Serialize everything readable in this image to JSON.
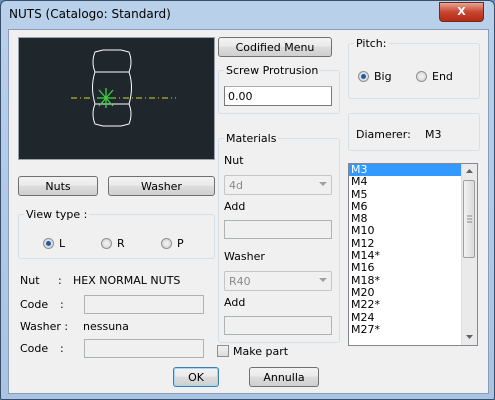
{
  "window": {
    "title": "NUTS (Catalogo: Standard)",
    "close_glyph": "X"
  },
  "buttons": {
    "codified_menu": "Codified Menu",
    "nuts": "Nuts",
    "washer": "Washer",
    "ok": "OK",
    "cancel": "Annulla"
  },
  "screw_protrusion": {
    "label": "Screw Protrusion",
    "value": "0.00"
  },
  "view_type": {
    "label": "View type  :",
    "options": [
      "L",
      "R",
      "P"
    ],
    "selected": "L"
  },
  "info": {
    "nut_label": "Nut",
    "nut_sep": ":",
    "nut_value": "HEX NORMAL NUTS",
    "code_label": "Code",
    "code_sep": ":",
    "washer_label": "Washer :",
    "washer_value": "nessuna",
    "code2_label": "Code",
    "code2_sep": ":"
  },
  "materials": {
    "label": "Materials",
    "nut_label": "Nut",
    "nut_value": "4d",
    "add1_label": "Add",
    "washer_label": "Washer",
    "washer_value": "R40",
    "add2_label": "Add"
  },
  "make_part": {
    "label": "Make part",
    "checked": false
  },
  "pitch": {
    "label": "Pitch:",
    "options": [
      "Big",
      "End"
    ],
    "selected": "Big"
  },
  "diameter": {
    "label": "Diamerer:",
    "value": "M3"
  },
  "sizes": {
    "items": [
      "M3",
      "M4",
      "M5",
      "M6",
      "M8",
      "M10",
      "M12",
      "M14*",
      "M16",
      "M18*",
      "M20",
      "M22*",
      "M24",
      "M27*"
    ],
    "selected": "M3"
  },
  "colors": {
    "preview_bg": "#1f262c",
    "crosshair": "#3fd03f",
    "centerline": "#d6d62a",
    "selection": "#3399ff"
  }
}
